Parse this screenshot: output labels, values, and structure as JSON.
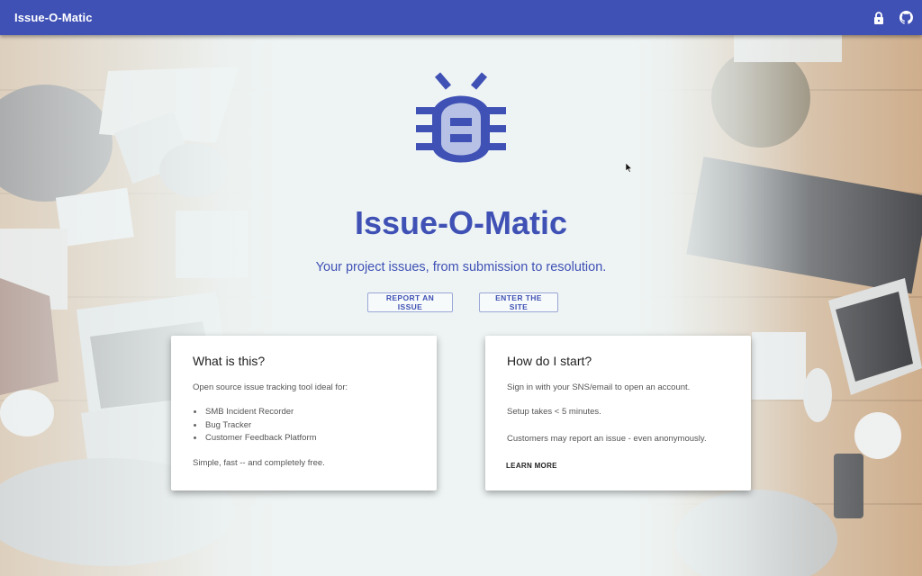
{
  "app": {
    "title": "Issue-O-Matic",
    "brand_color": "#3f51b5"
  },
  "appbar_icons": [
    "lock-icon",
    "github-icon"
  ],
  "hero": {
    "title": "Issue-O-Matic",
    "subtitle": "Your project issues, from submission to resolution.",
    "report_button_label": "REPORT AN ISSUE",
    "enter_button_label": "ENTER THE SITE",
    "logo_icon": "bug-icon"
  },
  "card_what": {
    "title": "What is this?",
    "intro": "Open source issue tracking tool ideal for:",
    "items": [
      "SMB Incident Recorder",
      "Bug Tracker",
      "Customer Feedback Platform"
    ],
    "outro": "Simple, fast -- and completely free."
  },
  "card_how": {
    "title": "How do I start?",
    "line1": "Sign in with your SNS/email to open an account.",
    "line2": "Setup takes < 5 minutes.",
    "line3": "Customers may report an issue - even anonymously.",
    "learn_more_label": "LEARN MORE"
  }
}
